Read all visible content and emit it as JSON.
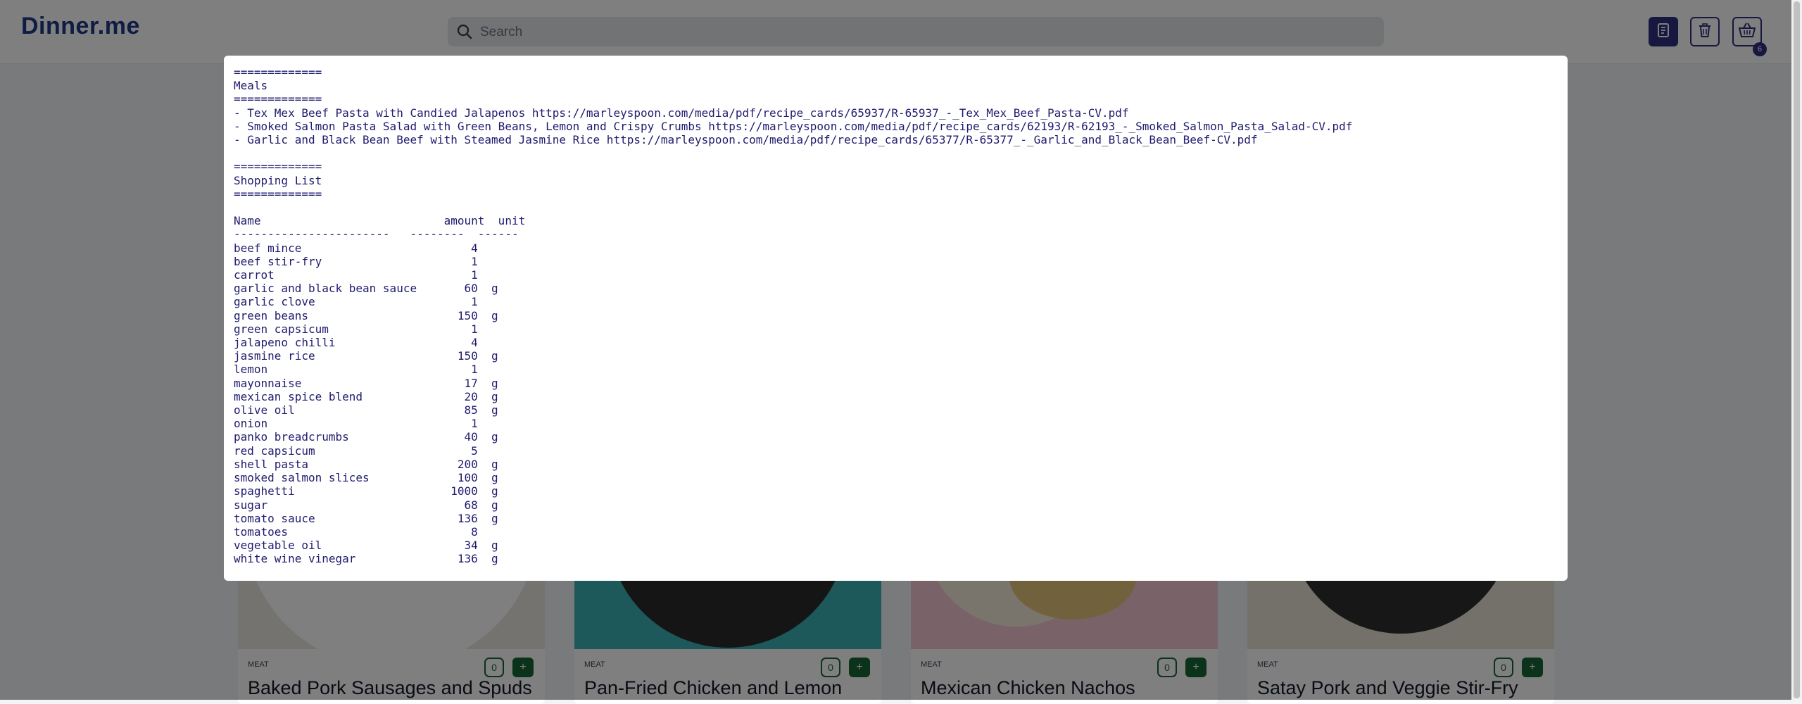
{
  "header": {
    "logo": "Dinner.me",
    "search_placeholder": "Search",
    "icons": [
      "search-icon",
      "document-icon",
      "trash-icon",
      "basket-icon"
    ],
    "cart_count": "6"
  },
  "cards": [
    {
      "category": "MEAT",
      "title": "Baked Pork Sausages and Spuds",
      "quantity": "0",
      "add_label": "+"
    },
    {
      "category": "MEAT",
      "title": "Pan-Fried Chicken and Lemon",
      "quantity": "0",
      "add_label": "+"
    },
    {
      "category": "MEAT",
      "title": "Mexican Chicken Nachos",
      "quantity": "0",
      "add_label": "+"
    },
    {
      "category": "MEAT",
      "title": "Satay Pork and Veggie Stir-Fry",
      "quantity": "0",
      "add_label": "+"
    }
  ],
  "modal": {
    "content": "=============\nMeals\n=============\n- Tex Mex Beef Pasta with Candied Jalapenos https://marleyspoon.com/media/pdf/recipe_cards/65937/R-65937_-_Tex_Mex_Beef_Pasta-CV.pdf\n- Smoked Salmon Pasta Salad with Green Beans, Lemon and Crispy Crumbs https://marleyspoon.com/media/pdf/recipe_cards/62193/R-62193_-_Smoked_Salmon_Pasta_Salad-CV.pdf\n- Garlic and Black Bean Beef with Steamed Jasmine Rice https://marleyspoon.com/media/pdf/recipe_cards/65377/R-65377_-_Garlic_and_Black_Bean_Beef-CV.pdf\n\n=============\nShopping List\n=============\n\nName                           amount  unit\n-----------------------   --------  ------\nbeef mince                         4\nbeef stir-fry                      1\ncarrot                             1\ngarlic and black bean sauce       60  g\ngarlic clove                       1\ngreen beans                      150  g\ngreen capsicum                     1\njalapeno chilli                    4\njasmine rice                     150  g\nlemon                              1\nmayonnaise                        17  g\nmexican spice blend               20  g\nolive oil                         85  g\nonion                              1\npanko breadcrumbs                 40  g\nred capsicum                       5\nshell pasta                      200  g\nsmoked salmon slices             100  g\nspaghetti                       1000  g\nsugar                             68  g\ntomato sauce                     136  g\ntomatoes                           8\nvegetable oil                     34  g\nwhite wine vinegar               136  g"
  },
  "colors": {
    "brand": "#1e3a8a",
    "button_primary": "#312e81",
    "accent_green": "#166534",
    "text_modal": "#1e1b6e"
  }
}
